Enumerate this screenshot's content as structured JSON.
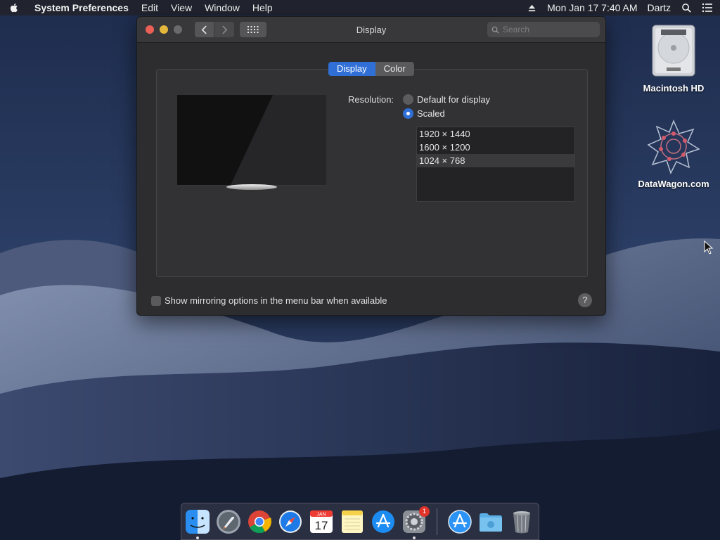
{
  "menubar": {
    "app_name": "System Preferences",
    "items": [
      "Edit",
      "View",
      "Window",
      "Help"
    ],
    "datetime": "Mon Jan 17  7:40 AM",
    "user": "Dartz"
  },
  "desktop": {
    "icons": [
      {
        "label": "Macintosh HD"
      },
      {
        "label": "DataWagon.com"
      }
    ]
  },
  "window": {
    "title": "Display",
    "search_placeholder": "Search",
    "tabs": [
      {
        "label": "Display",
        "active": true
      },
      {
        "label": "Color",
        "active": false
      }
    ],
    "resolution_label": "Resolution:",
    "options": [
      {
        "label": "Default for display",
        "selected": false
      },
      {
        "label": "Scaled",
        "selected": true
      }
    ],
    "resolutions": [
      "1920 × 1440",
      "1600 × 1200",
      "1024 × 768"
    ],
    "selected_resolution": "1024 × 768",
    "mirroring_label": "Show mirroring options in the menu bar when available",
    "help_label": "?"
  },
  "dock": {
    "apps": [
      "Finder",
      "Launchpad",
      "Chrome",
      "Safari",
      "Calendar",
      "Notes",
      "App Store",
      "System Preferences",
      "App Store Downloads",
      "Folder",
      "Trash"
    ],
    "calendar_month": "JAN",
    "calendar_day": "17",
    "sysprefs_badge": "1"
  },
  "colors": {
    "accent": "#2f6fd6",
    "close": "#ec5f57",
    "minimize": "#e3b83d",
    "zoom": "#6a6a6c"
  }
}
